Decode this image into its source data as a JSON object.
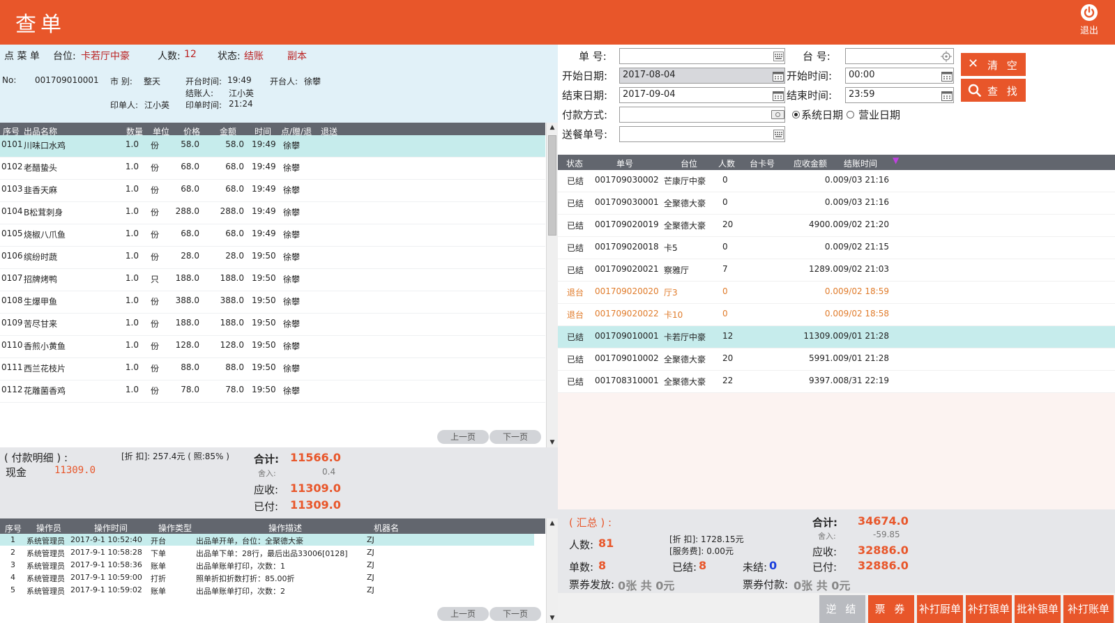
{
  "header": {
    "title": "查单",
    "logout_label": "退出"
  },
  "order_info": {
    "menu_label": "点 菜 单",
    "table_label": "台位:",
    "table_value": "卡若厅中豪",
    "guests_label": "人数:",
    "guests_value": "12",
    "status_label": "状态:",
    "status_value": "结账",
    "copy_label": "副本",
    "no_label": "No:",
    "no_value": "001709010001",
    "market_label": "市  别:",
    "market_value": "整天",
    "open_time_label": "开台时间:",
    "open_time_value": "19:49",
    "opener_label": "开台人:",
    "opener_value": "徐攀",
    "checkout_person_label": "结账人:",
    "checkout_person_value": "江小英",
    "printer_label": "印单人:",
    "printer_value": "江小英",
    "print_time_label": "印单时间:",
    "print_time_value": "21:24"
  },
  "items_table": {
    "headers": [
      "序号",
      "出品名称",
      "数量",
      "单位",
      "价格",
      "金额",
      "时间",
      "点/赠/退",
      "退送"
    ],
    "rows": [
      {
        "no": "0101",
        "name": "川味口水鸡",
        "qty": "1.0",
        "unit": "份",
        "price": "58.0",
        "amount": "58.0",
        "time": "19:49",
        "person": "徐攀"
      },
      {
        "no": "0102",
        "name": "老醋蛰头",
        "qty": "1.0",
        "unit": "份",
        "price": "68.0",
        "amount": "68.0",
        "time": "19:49",
        "person": "徐攀"
      },
      {
        "no": "0103",
        "name": "韭香天麻",
        "qty": "1.0",
        "unit": "份",
        "price": "68.0",
        "amount": "68.0",
        "time": "19:49",
        "person": "徐攀"
      },
      {
        "no": "0104",
        "name": "B松茸刺身",
        "qty": "1.0",
        "unit": "份",
        "price": "288.0",
        "amount": "288.0",
        "time": "19:49",
        "person": "徐攀"
      },
      {
        "no": "0105",
        "name": "烧椒八爪鱼",
        "qty": "1.0",
        "unit": "份",
        "price": "68.0",
        "amount": "68.0",
        "time": "19:49",
        "person": "徐攀"
      },
      {
        "no": "0106",
        "name": "缤纷时蔬",
        "qty": "1.0",
        "unit": "份",
        "price": "28.0",
        "amount": "28.0",
        "time": "19:50",
        "person": "徐攀"
      },
      {
        "no": "0107",
        "name": "招牌烤鸭",
        "qty": "1.0",
        "unit": "只",
        "price": "188.0",
        "amount": "188.0",
        "time": "19:50",
        "person": "徐攀"
      },
      {
        "no": "0108",
        "name": "生爆甲鱼",
        "qty": "1.0",
        "unit": "份",
        "price": "388.0",
        "amount": "388.0",
        "time": "19:50",
        "person": "徐攀"
      },
      {
        "no": "0109",
        "name": "苦尽甘来",
        "qty": "1.0",
        "unit": "份",
        "price": "188.0",
        "amount": "188.0",
        "time": "19:50",
        "person": "徐攀"
      },
      {
        "no": "0110",
        "name": "香煎小黄鱼",
        "qty": "1.0",
        "unit": "份",
        "price": "128.0",
        "amount": "128.0",
        "time": "19:50",
        "person": "徐攀"
      },
      {
        "no": "0111",
        "name": "西兰花枝片",
        "qty": "1.0",
        "unit": "份",
        "price": "88.0",
        "amount": "88.0",
        "time": "19:50",
        "person": "徐攀"
      },
      {
        "no": "0112",
        "name": "花雕菌香鸡",
        "qty": "1.0",
        "unit": "份",
        "price": "78.0",
        "amount": "78.0",
        "time": "19:50",
        "person": "徐攀"
      }
    ],
    "prev_label": "上一页",
    "next_label": "下一页"
  },
  "payment": {
    "detail_label": "( 付款明细 ) :",
    "cash_label": "现金",
    "cash_value": "11309.0",
    "discount_text": "[折  扣]: 257.4元 ( 照:85% )",
    "total_label": "合计:",
    "total_value": "11566.0",
    "rounding_label": "舍入:",
    "rounding_value": "0.4",
    "receivable_label": "应收:",
    "receivable_value": "11309.0",
    "paid_label": "已付:",
    "paid_value": "11309.0"
  },
  "log_table": {
    "headers": [
      "序号",
      "操作员",
      "操作时间",
      "操作类型",
      "操作描述",
      "机器名"
    ],
    "rows": [
      {
        "no": "1",
        "operator": "系统管理员",
        "time": "2017-9-1  10:52:40",
        "type": "开台",
        "desc": "出品单开单，台位：全聚德大豪",
        "machine": "ZJ"
      },
      {
        "no": "2",
        "operator": "系统管理员",
        "time": "2017-9-1  10:58:28",
        "type": "下单",
        "desc": "出品单下单：28行，最后出品33006[0128]",
        "machine": "ZJ"
      },
      {
        "no": "3",
        "operator": "系统管理员",
        "time": "2017-9-1  10:58:36",
        "type": "账单",
        "desc": "出品单账单打印，次数：1",
        "machine": "ZJ"
      },
      {
        "no": "4",
        "operator": "系统管理员",
        "time": "2017-9-1  10:59:00",
        "type": "打折",
        "desc": "照单折扣折数打折：85.00折",
        "machine": "ZJ"
      },
      {
        "no": "5",
        "operator": "系统管理员",
        "time": "2017-9-1  10:59:02",
        "type": "账单",
        "desc": "出品单账单打印，次数：2",
        "machine": "ZJ"
      }
    ],
    "prev_label": "上一页",
    "next_label": "下一页"
  },
  "filters": {
    "order_no_label": "单  号:",
    "order_no_value": "",
    "table_no_label": "台  号:",
    "table_no_value": "",
    "start_date_label": "开始日期:",
    "start_date_value": "2017-08-04",
    "start_time_label": "开始时间:",
    "start_time_value": "00:00",
    "end_date_label": "结束日期:",
    "end_date_value": "2017-09-04",
    "end_time_label": "结束时间:",
    "end_time_value": "23:59",
    "payment_label": "付款方式:",
    "payment_value": "",
    "delivery_label": "送餐单号:",
    "delivery_value": "",
    "radio_system": "系统日期",
    "radio_business": "营业日期",
    "clear_label": "清 空",
    "search_label": "查 找"
  },
  "orders_table": {
    "headers": [
      "状态",
      "单号",
      "台位",
      "人数",
      "台卡号",
      "应收金额",
      "结账时间"
    ],
    "rows": [
      {
        "status": "已结",
        "no": "001709030002",
        "table": "芒康厅中豪",
        "guests": "0",
        "amount": "0.0",
        "time": "09/03 21:16",
        "kind": "normal"
      },
      {
        "status": "已结",
        "no": "001709030001",
        "table": "全聚德大豪",
        "guests": "0",
        "amount": "0.0",
        "time": "09/03 21:16",
        "kind": "normal"
      },
      {
        "status": "已结",
        "no": "001709020019",
        "table": "全聚德大豪",
        "guests": "20",
        "amount": "4900.0",
        "time": "09/02 21:20",
        "kind": "normal"
      },
      {
        "status": "已结",
        "no": "001709020018",
        "table": "卡5",
        "guests": "0",
        "amount": "0.0",
        "time": "09/02 21:15",
        "kind": "normal"
      },
      {
        "status": "已结",
        "no": "001709020021",
        "table": "察雅厅",
        "guests": "7",
        "amount": "1289.0",
        "time": "09/02 21:03",
        "kind": "normal"
      },
      {
        "status": "退台",
        "no": "001709020020",
        "table": "厅3",
        "guests": "0",
        "amount": "0.0",
        "time": "09/02 18:59",
        "kind": "refund"
      },
      {
        "status": "退台",
        "no": "001709020022",
        "table": "卡10",
        "guests": "0",
        "amount": "0.0",
        "time": "09/02 18:58",
        "kind": "refund"
      },
      {
        "status": "已结",
        "no": "001709010001",
        "table": "卡若厅中豪",
        "guests": "12",
        "amount": "11309.0",
        "time": "09/01 21:28",
        "kind": "selected"
      },
      {
        "status": "已结",
        "no": "001709010002",
        "table": "全聚德大豪",
        "guests": "20",
        "amount": "5991.0",
        "time": "09/01 21:28",
        "kind": "normal"
      },
      {
        "status": "已结",
        "no": "001708310001",
        "table": "全聚德大豪",
        "guests": "22",
        "amount": "9397.0",
        "time": "08/31 22:19",
        "kind": "normal"
      }
    ]
  },
  "summary": {
    "title": "( 汇总 ) :",
    "guests_label": "人数:",
    "guests_value": "81",
    "orders_label": "单数:",
    "orders_value": "8",
    "settled_label": "已结:",
    "settled_value": "8",
    "unsettled_label": "未结:",
    "unsettled_value": "0",
    "discount_text": "[折  扣]: 1728.15元",
    "service_text": "[服务费]: 0.00元",
    "total_label": "合计:",
    "total_value": "34674.0",
    "rounding_label": "舍入:",
    "rounding_value": "-59.85",
    "receivable_label": "应收:",
    "receivable_value": "32886.0",
    "paid_label": "已付:",
    "paid_value": "32886.0",
    "voucher_issue_label": "票券发放:",
    "voucher_issue_value": "0张 共 0元",
    "voucher_pay_label": "票券付款:",
    "voucher_pay_value": "0张 共 0元"
  },
  "actions": {
    "reverse": "逆 结",
    "voucher": "票 券",
    "reprint_kitchen": "补打厨单",
    "reprint_silver": "补打银单",
    "batch_silver": "批补银单",
    "reprint_bill": "补打账单"
  },
  "colors": {
    "accent": "#E8562A",
    "header_bg": "#E8562A",
    "table_header_bg": "#62666E",
    "selected_row": "#C6ECEC",
    "info_bg": "#E1F1F8",
    "refund_text": "#E07B2A",
    "unsettled_blue": "#1A3EDC"
  }
}
